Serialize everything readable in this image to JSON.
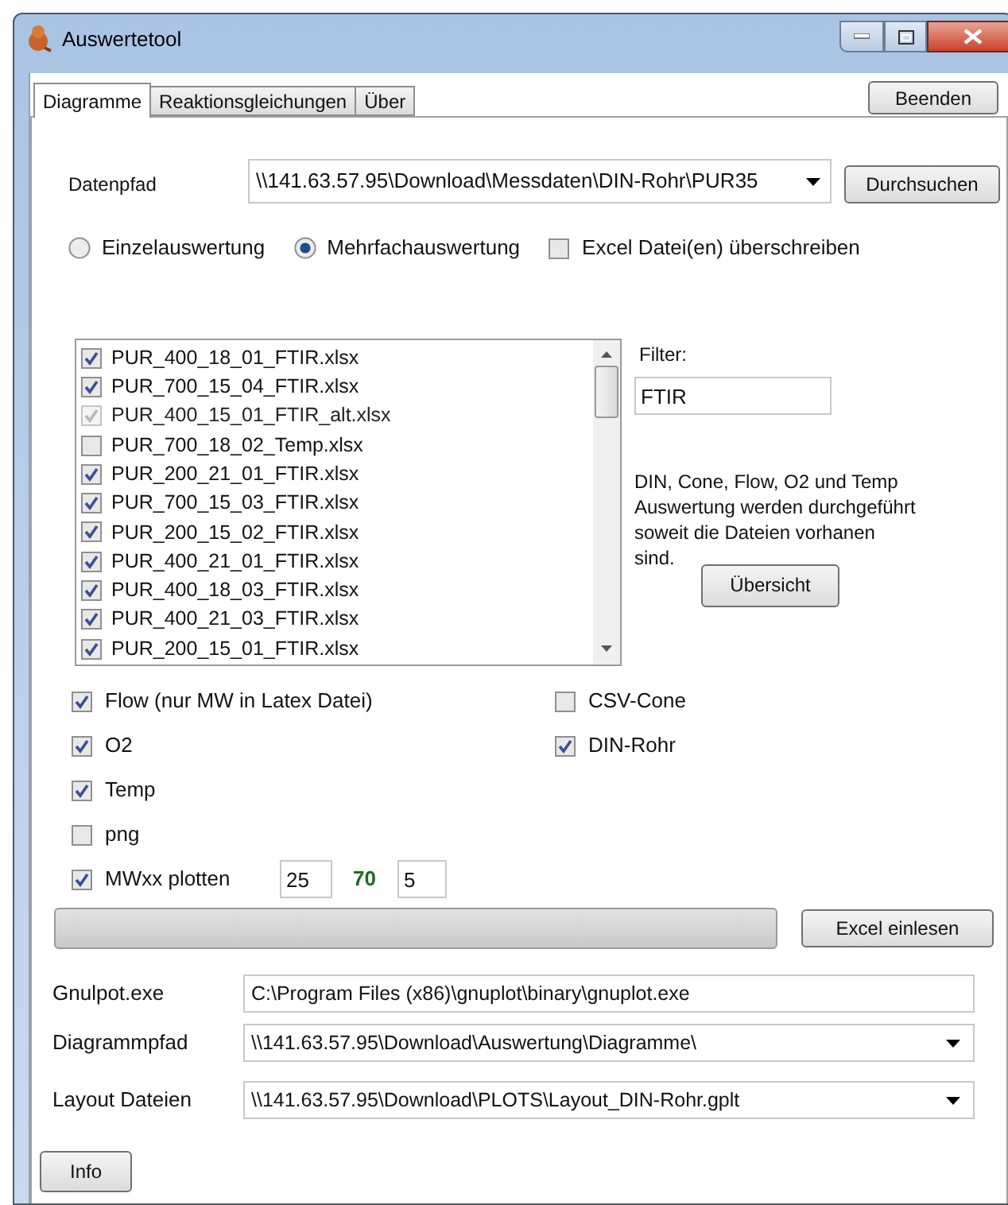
{
  "window": {
    "title": "Auswertetool"
  },
  "tabs": [
    {
      "label": "Diagramme",
      "selected": true
    },
    {
      "label": "Reaktionsgleichungen",
      "selected": false
    },
    {
      "label": "Über",
      "selected": false
    }
  ],
  "close_button": "Beenden",
  "data_path": {
    "label": "Datenpfad",
    "value": "\\\\141.63.57.95\\Download\\Messdaten\\DIN-Rohr\\PUR35"
  },
  "browse_button": "Durchsuchen",
  "modes": [
    {
      "label": "Einzelauswertung",
      "selected": false
    },
    {
      "label": "Mehrfachauswertung",
      "selected": true
    }
  ],
  "overwrite_excel": {
    "label": "Excel Datei(en) überschreiben",
    "checked": false
  },
  "files": [
    {
      "name": "PUR_400_18_01_FTIR.xlsx",
      "checked": true,
      "disabled": false
    },
    {
      "name": "PUR_700_15_04_FTIR.xlsx",
      "checked": true,
      "disabled": false
    },
    {
      "name": "PUR_400_15_01_FTIR_alt.xlsx",
      "checked": true,
      "disabled": true
    },
    {
      "name": "PUR_700_18_02_Temp.xlsx",
      "checked": false,
      "disabled": false
    },
    {
      "name": "PUR_200_21_01_FTIR.xlsx",
      "checked": true,
      "disabled": false
    },
    {
      "name": "PUR_700_15_03_FTIR.xlsx",
      "checked": true,
      "disabled": false
    },
    {
      "name": "PUR_200_15_02_FTIR.xlsx",
      "checked": true,
      "disabled": false
    },
    {
      "name": "PUR_400_21_01_FTIR.xlsx",
      "checked": true,
      "disabled": false
    },
    {
      "name": "PUR_400_18_03_FTIR.xlsx",
      "checked": true,
      "disabled": false
    },
    {
      "name": "PUR_400_21_03_FTIR.xlsx",
      "checked": true,
      "disabled": false
    },
    {
      "name": "PUR_200_15_01_FTIR.xlsx",
      "checked": true,
      "disabled": false
    }
  ],
  "filter": {
    "label": "Filter:",
    "value": "FTIR"
  },
  "info_text": "DIN, Cone, Flow, O2 und Temp Auswertung werden durchgeführt soweit die Dateien vorhanen sind.",
  "overview_button": "Übersicht",
  "options_left": [
    {
      "label": "Flow (nur MW in Latex Datei)",
      "checked": true
    },
    {
      "label": "O2",
      "checked": true
    },
    {
      "label": "Temp",
      "checked": true
    },
    {
      "label": "png",
      "checked": false
    }
  ],
  "options_right": [
    {
      "label": "CSV-Cone",
      "checked": false
    },
    {
      "label": "DIN-Rohr",
      "checked": true
    }
  ],
  "mw_plot": {
    "label": "MWxx plotten",
    "checked": true,
    "from": "25",
    "mid": "70",
    "to": "5"
  },
  "progress": {
    "level": 0
  },
  "read_excel_button": "Excel einlesen",
  "gnuplot": {
    "label": "Gnulpot.exe",
    "value": "C:\\Program Files (x86)\\gnuplot\\binary\\gnuplot.exe"
  },
  "diagram_path": {
    "label": "Diagrammpfad",
    "value": "\\\\141.63.57.95\\Download\\Auswertung\\Diagramme\\"
  },
  "layout_files": {
    "label": "Layout Dateien",
    "value": "\\\\141.63.57.95\\Download\\PLOTS\\Layout_DIN-Rohr.gplt"
  },
  "info_button": "Info"
}
